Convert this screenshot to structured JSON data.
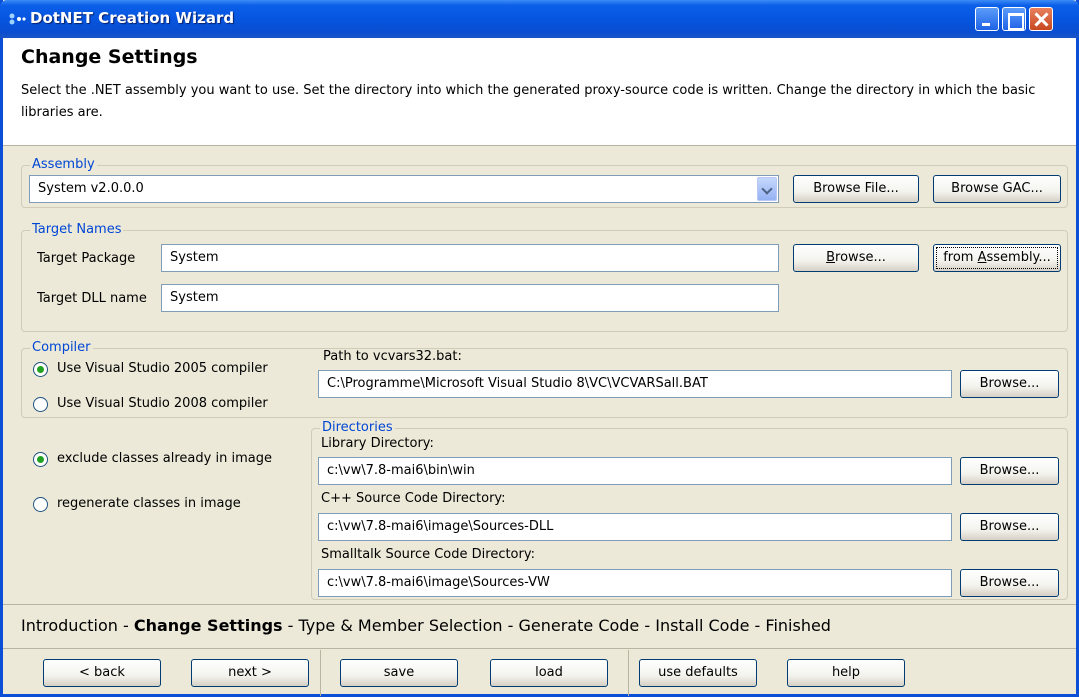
{
  "window": {
    "title": "DotNET Creation Wizard"
  },
  "header": {
    "title": "Change Settings",
    "description": "Select the .NET assembly you want to use. Set the directory into which the generated proxy-source code is written. Change the directory in which the basic libraries are."
  },
  "assembly": {
    "group_label": "Assembly",
    "selected": "System v2.0.0.0",
    "browse_file": "Browse File...",
    "browse_gac": "Browse GAC..."
  },
  "target_names": {
    "group_label": "Target Names",
    "package_label": "Target Package",
    "package_value": "System",
    "dll_label": "Target DLL name",
    "dll_value": "System",
    "browse": "Browse...",
    "from_assembly": "from Assembly..."
  },
  "compiler": {
    "group_label": "Compiler",
    "option_2005": "Use Visual Studio 2005 compiler",
    "option_2008": "Use Visual Studio 2008 compiler",
    "selected": "2005",
    "path_label": "Path to vcvars32.bat:",
    "path_value": "C:\\Programme\\Microsoft Visual Studio 8\\VC\\VCVARSall.BAT",
    "browse": "Browse..."
  },
  "classes": {
    "option_exclude": "exclude classes already in image",
    "option_regenerate": "regenerate classes in image",
    "selected": "exclude"
  },
  "directories": {
    "group_label": "Directories",
    "library_label": "Library Directory:",
    "library_value": "c:\\vw\\7.8-mai6\\bin\\win",
    "cpp_label": "C++ Source Code Directory:",
    "cpp_value": "c:\\vw\\7.8-mai6\\image\\Sources-DLL",
    "smalltalk_label": "Smalltalk Source Code Directory:",
    "smalltalk_value": "c:\\vw\\7.8-mai6\\image\\Sources-VW",
    "browse": "Browse..."
  },
  "steps": {
    "introduction": "Introduction",
    "change_settings": "Change Settings",
    "type_member": "Type & Member Selection",
    "generate_code": "Generate Code",
    "install_code": "Install Code",
    "finished": "Finished",
    "separator": " - "
  },
  "footer": {
    "back": "< back",
    "next": "next >",
    "save": "save",
    "load": "load",
    "use_defaults": "use defaults",
    "help": "help"
  }
}
